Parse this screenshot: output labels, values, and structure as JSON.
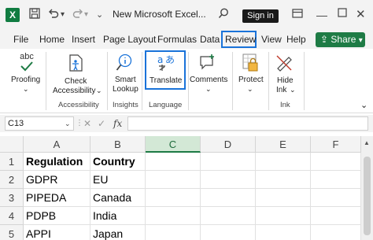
{
  "titlebar": {
    "app_icon": "X",
    "save_icon": "save-icon",
    "undo_icon": "undo-icon",
    "redo_icon": "redo-icon",
    "more_icon": "chevron-down-icon",
    "title": "New Microsoft Excel...",
    "search_icon": "search-icon",
    "sign_in": "Sign in",
    "ribbon_icon": "ribbon-display-icon"
  },
  "menu": {
    "tabs": [
      "File",
      "Home",
      "Insert",
      "Page Layout",
      "Formulas",
      "Data",
      "Review",
      "View",
      "Help"
    ],
    "active_tab": "Review",
    "share": "Share"
  },
  "ribbon": {
    "proofing": {
      "label": "Proofing",
      "icon_text": "abc"
    },
    "check_accessibility": {
      "line1": "Check",
      "line2": "Accessibility"
    },
    "smart_lookup": {
      "line1": "Smart",
      "line2": "Lookup"
    },
    "translate": {
      "label": "Translate"
    },
    "comments": {
      "label": "Comments"
    },
    "protect": {
      "label": "Protect"
    },
    "hide_ink": {
      "line1": "Hide",
      "line2": "Ink"
    },
    "groups": {
      "accessibility": "Accessibility",
      "insights": "Insights",
      "language": "Language",
      "ink": "Ink"
    }
  },
  "formula_bar": {
    "name_box": "C13",
    "fx": "fx",
    "value": ""
  },
  "sheet": {
    "columns": [
      "A",
      "B",
      "C",
      "D",
      "E",
      "F"
    ],
    "selected_column": "C",
    "rows": [
      {
        "num": "1",
        "cells": [
          "Regulation",
          "Country"
        ]
      },
      {
        "num": "2",
        "cells": [
          "GDPR",
          "EU"
        ]
      },
      {
        "num": "3",
        "cells": [
          "PIPEDA",
          "Canada"
        ]
      },
      {
        "num": "4",
        "cells": [
          "PDPB",
          "India"
        ]
      },
      {
        "num": "5",
        "cells": [
          "APPI",
          "Japan"
        ]
      }
    ]
  },
  "colors": {
    "accent": "#1e7b45",
    "highlight": "#1a73d9"
  }
}
